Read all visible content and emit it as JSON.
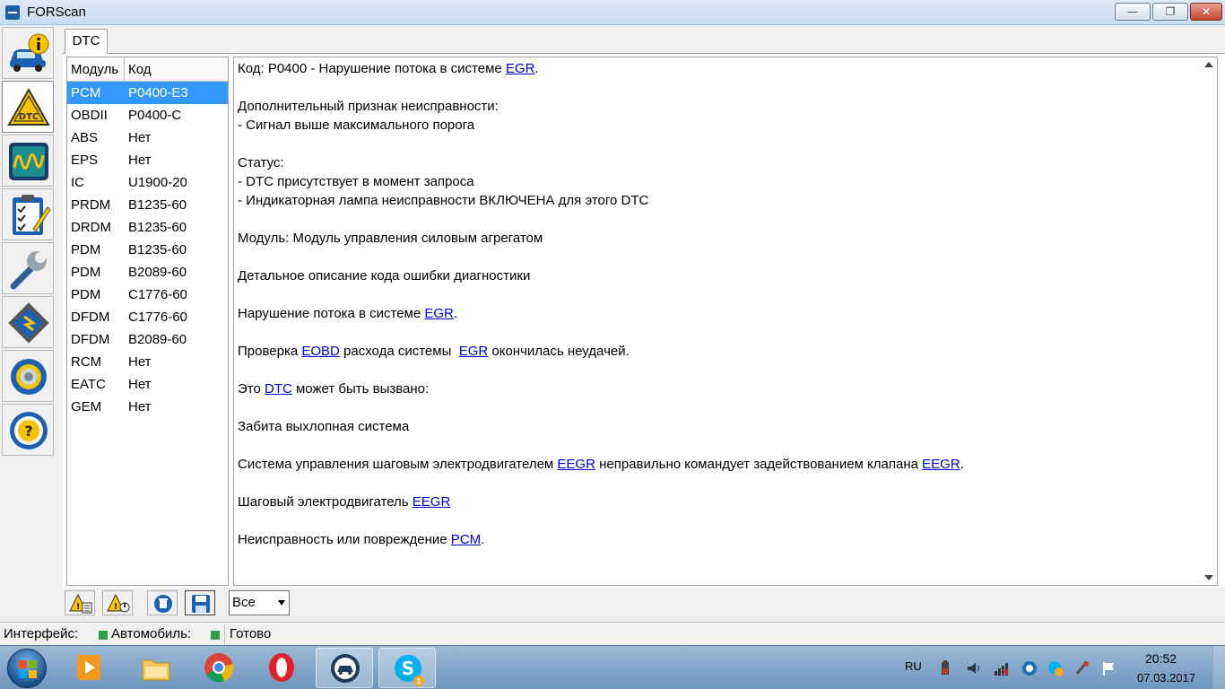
{
  "window": {
    "title": "FORScan",
    "min_glyph": "—",
    "max_glyph": "❐",
    "close_glyph": "✕"
  },
  "tabs": [
    {
      "label": "DTC"
    }
  ],
  "dtc_table": {
    "headers": {
      "module": "Модуль",
      "code": "Код"
    },
    "rows": [
      {
        "module": "PCM",
        "code": "P0400-E3",
        "selected": true
      },
      {
        "module": "OBDII",
        "code": "P0400-C"
      },
      {
        "module": "ABS",
        "code": "Нет"
      },
      {
        "module": "EPS",
        "code": "Нет"
      },
      {
        "module": "IC",
        "code": "U1900-20"
      },
      {
        "module": "PRDM",
        "code": "B1235-60"
      },
      {
        "module": "DRDM",
        "code": "B1235-60"
      },
      {
        "module": "PDM",
        "code": "B1235-60"
      },
      {
        "module": "PDM",
        "code": "B2089-60"
      },
      {
        "module": "PDM",
        "code": "C1776-60"
      },
      {
        "module": "DFDM",
        "code": "C1776-60"
      },
      {
        "module": "DFDM",
        "code": "B2089-60"
      },
      {
        "module": "RCM",
        "code": "Нет"
      },
      {
        "module": "EATC",
        "code": "Нет"
      },
      {
        "module": "GEM",
        "code": "Нет"
      }
    ]
  },
  "detail": {
    "p1_prefix": "Код: P0400 - Нарушение потока в системе ",
    "p1_link": "EGR",
    "p1_suffix": ".",
    "p2_title": "Дополнительный признак неисправности:",
    "p2_item": " - Сигнал выше максимального порога",
    "p3_title": "Статус:",
    "p3_item1": " - DTC присутствует в момент запроса",
    "p3_item2": " - Индикаторная лампа неисправности ВКЛЮЧЕНА для этого DTC",
    "p4": "Модуль: Модуль управления силовым агрегатом",
    "p5": "Детальное описание кода ошибки диагностики",
    "p6_prefix": "Нарушение потока в системе ",
    "p6_link": "EGR",
    "p6_suffix": ".",
    "p7_prefix": "Проверка ",
    "p7_link1": "EOBD",
    "p7_mid": " расхода системы  ",
    "p7_link2": "EGR",
    "p7_suffix": " окончилась неудачей.",
    "p8_prefix": "Это ",
    "p8_link": "DTC",
    "p8_suffix": " может быть вызвано:",
    "p9": "Забита выхлопная система",
    "p10_prefix": "Система управления шаговым электродвигателем ",
    "p10_link1": "EEGR",
    "p10_mid": " неправильно командует задействованием клапана ",
    "p10_link2": "EEGR",
    "p10_suffix": ".",
    "p11_prefix": "Шаговый электродвигатель ",
    "p11_link": "EEGR",
    "p12_prefix": "Неисправность или повреждение ",
    "p12_link": "PCM",
    "p12_suffix": "."
  },
  "bottom_toolbar": {
    "filter_value": "Все"
  },
  "status_bar": {
    "interface_label": "Интерфейс:",
    "vehicle_label": "Автомобиль:",
    "state_text": "Готово",
    "led_color": "#2e9f4d"
  },
  "left_toolbar": {
    "items": [
      "vehicle-info-icon",
      "dtc-icon",
      "oscilloscope-icon",
      "checklist-icon",
      "wrench-icon",
      "chip-icon",
      "settings-gear-icon",
      "help-icon"
    ]
  },
  "taskbar": {
    "language": "RU",
    "time": "20:52",
    "date": "07.03.2017",
    "apps": [
      "media-player-icon",
      "file-explorer-icon",
      "chrome-icon",
      "opera-icon",
      "forscan-icon",
      "skype-icon"
    ]
  }
}
